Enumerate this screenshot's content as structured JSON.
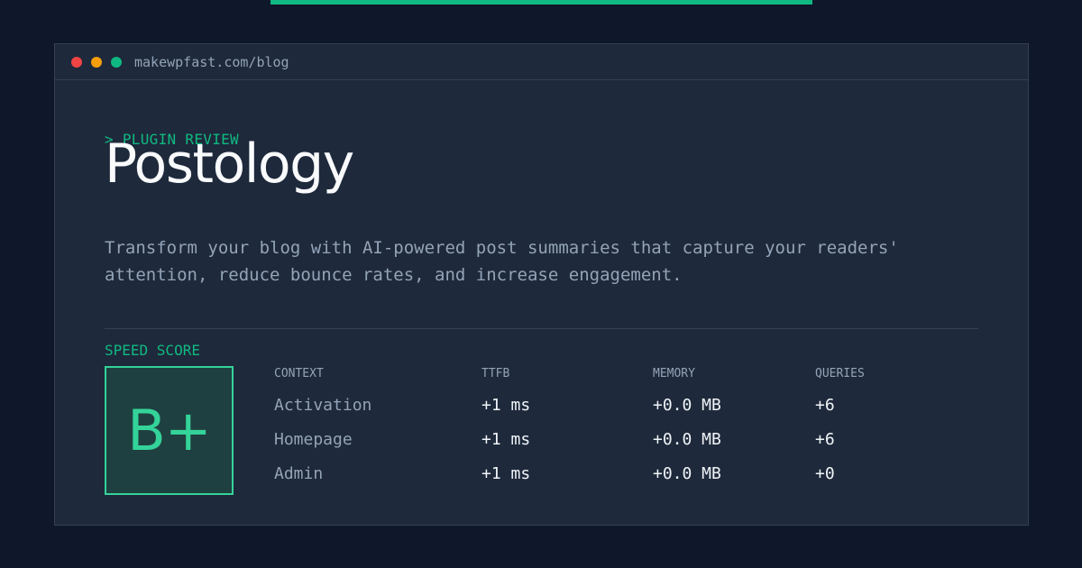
{
  "browser": {
    "url": "makewpfast.com/blog"
  },
  "header": {
    "eyebrow": "> PLUGIN REVIEW",
    "title": "Postology",
    "description": "Transform your blog with AI-powered post summaries that capture your readers' attention, reduce bounce rates, and increase engagement."
  },
  "speed": {
    "label": "SPEED SCORE",
    "grade": "B+"
  },
  "metrics": {
    "headers": {
      "context": "CONTEXT",
      "ttfb": "TTFB",
      "memory": "MEMORY",
      "queries": "QUERIES"
    },
    "rows": [
      {
        "context": "Activation",
        "ttfb": "+1 ms",
        "memory": "+0.0 MB",
        "queries": "+6"
      },
      {
        "context": "Homepage",
        "ttfb": "+1 ms",
        "memory": "+0.0 MB",
        "queries": "+6"
      },
      {
        "context": "Admin",
        "ttfb": "+1 ms",
        "memory": "+0.0 MB",
        "queries": "+0"
      }
    ]
  },
  "colors": {
    "background": "#0f172a",
    "panel": "#1e293b",
    "accent": "#10b981",
    "grade": "#34d399",
    "traffic_red": "#ef4444",
    "traffic_yellow": "#f59e0b",
    "traffic_green": "#10b981"
  }
}
